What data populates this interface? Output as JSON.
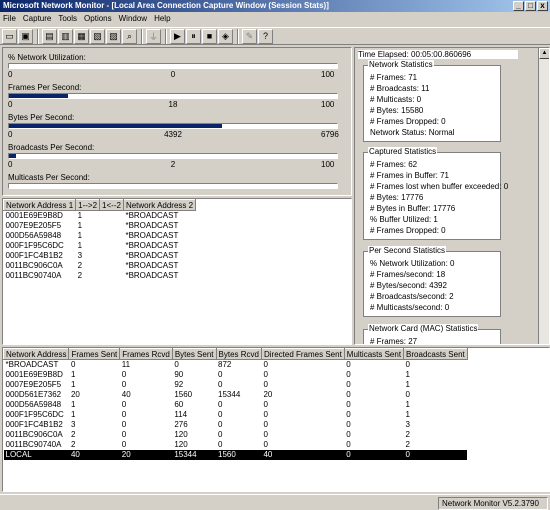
{
  "window": {
    "title": "Microsoft Network Monitor - [Local Area Connection Capture Window (Session Stats)]",
    "min": "_",
    "max": "□",
    "close": "x"
  },
  "menu": [
    "File",
    "Capture",
    "Tools",
    "Options",
    "Window",
    "Help"
  ],
  "toolbar": {
    "icons": [
      "open-icon",
      "save-icon",
      "separator",
      "pane-icon-1",
      "pane-icon-2",
      "pane-icon-3",
      "pane-icon-4",
      "print-icon",
      "find-icon",
      "separator",
      "filter-icon",
      "separator",
      "start-icon",
      "pause-icon",
      "stop-icon",
      "stop-view-icon",
      "separator",
      "edit-icon",
      "help-icon"
    ],
    "glyphs": {
      "open-icon": "▭",
      "save-icon": "▣",
      "pane-icon-1": "▤",
      "pane-icon-2": "▥",
      "pane-icon-3": "▦",
      "pane-icon-4": "▧",
      "print-icon": "▨",
      "find-icon": "⌕",
      "filter-icon": "⏚",
      "start-icon": "▶",
      "pause-icon": "⏸",
      "stop-icon": "■",
      "stop-view-icon": "◈",
      "edit-icon": "✎",
      "help-icon": "?"
    }
  },
  "gauges": [
    {
      "label": "% Network Utilization:",
      "min": "0",
      "mid": "0",
      "max": "100",
      "level": 0.0
    },
    {
      "label": "Frames Per Second:",
      "min": "0",
      "mid": "18",
      "max": "100",
      "level": 0.18
    },
    {
      "label": "Bytes Per Second:",
      "min": "0",
      "mid": "4392",
      "max": "6796",
      "level": 0.65
    },
    {
      "label": "Broadcasts Per Second:",
      "min": "0",
      "mid": "2",
      "max": "100",
      "level": 0.02
    },
    {
      "label": "Multicasts Per Second:",
      "min": "",
      "mid": "",
      "max": "",
      "level": 0.0
    }
  ],
  "stats": {
    "elapsed": "Time Elapsed: 00:05:00.860696",
    "groups": [
      {
        "title": "Network Statistics",
        "rows": [
          "# Frames: 71",
          "# Broadcasts: 11",
          "# Multicasts: 0",
          "# Bytes: 15580",
          "# Frames Dropped: 0",
          "Network Status: Normal"
        ]
      },
      {
        "title": "Captured Statistics",
        "rows": [
          "# Frames: 62",
          "# Frames in Buffer: 71",
          "# Frames lost when buffer exceeded: 0",
          "# Bytes: 17776",
          "# Bytes in Buffer: 17776",
          "% Buffer Utilized: 1",
          "# Frames Dropped: 0"
        ]
      },
      {
        "title": "Per Second Statistics",
        "rows": [
          "% Network Utilization: 0",
          "# Frames/second: 18",
          "# Bytes/second: 4392",
          "# Broadcasts/second: 2",
          "# Multicasts/second: 0"
        ]
      },
      {
        "title": "Network Card (MAC) Statistics",
        "rows": [
          "# Frames: 27"
        ]
      }
    ]
  },
  "address_table": {
    "headers": [
      "Network Address 1",
      "1-->2",
      "1<--2",
      "Network Address 2"
    ],
    "rows": [
      [
        "0001E69E9B8D",
        "1",
        "",
        "*BROADCAST"
      ],
      [
        "0007E9E205F5",
        "1",
        "",
        "*BROADCAST"
      ],
      [
        "000D56A59848",
        "1",
        "",
        "*BROADCAST"
      ],
      [
        "000F1F95C6DC",
        "1",
        "",
        "*BROADCAST"
      ],
      [
        "000F1FC4B1B2",
        "3",
        "",
        "*BROADCAST"
      ],
      [
        "0011BC906C0A",
        "2",
        "",
        "*BROADCAST"
      ],
      [
        "0011BC90740A",
        "2",
        "",
        "*BROADCAST"
      ]
    ]
  },
  "station_table": {
    "headers": [
      "Network Address",
      "Frames Sent",
      "Frames Rcvd",
      "Bytes Sent",
      "Bytes Rcvd",
      "Directed Frames Sent",
      "Multicasts Sent",
      "Broadcasts Sent"
    ],
    "rows": [
      [
        "*BROADCAST",
        "0",
        "11",
        "0",
        "872",
        "0",
        "0",
        "0"
      ],
      [
        "0001E69E9B8D",
        "1",
        "0",
        "90",
        "0",
        "0",
        "0",
        "1"
      ],
      [
        "0007E9E205F5",
        "1",
        "0",
        "92",
        "0",
        "0",
        "0",
        "1"
      ],
      [
        "000D561E7362",
        "20",
        "40",
        "1560",
        "15344",
        "20",
        "0",
        "0"
      ],
      [
        "000D56A59848",
        "1",
        "0",
        "60",
        "0",
        "0",
        "0",
        "1"
      ],
      [
        "000F1F95C6DC",
        "1",
        "0",
        "114",
        "0",
        "0",
        "0",
        "1"
      ],
      [
        "000F1FC4B1B2",
        "3",
        "0",
        "276",
        "0",
        "0",
        "0",
        "3"
      ],
      [
        "0011BC906C0A",
        "2",
        "0",
        "120",
        "0",
        "0",
        "0",
        "2"
      ],
      [
        "0011BC90740A",
        "2",
        "0",
        "120",
        "0",
        "0",
        "0",
        "2"
      ],
      [
        "LOCAL",
        "40",
        "20",
        "15344",
        "1560",
        "40",
        "0",
        "0"
      ]
    ],
    "selected_row": 9
  },
  "status": {
    "version": "Network Monitor V5.2.3790"
  }
}
